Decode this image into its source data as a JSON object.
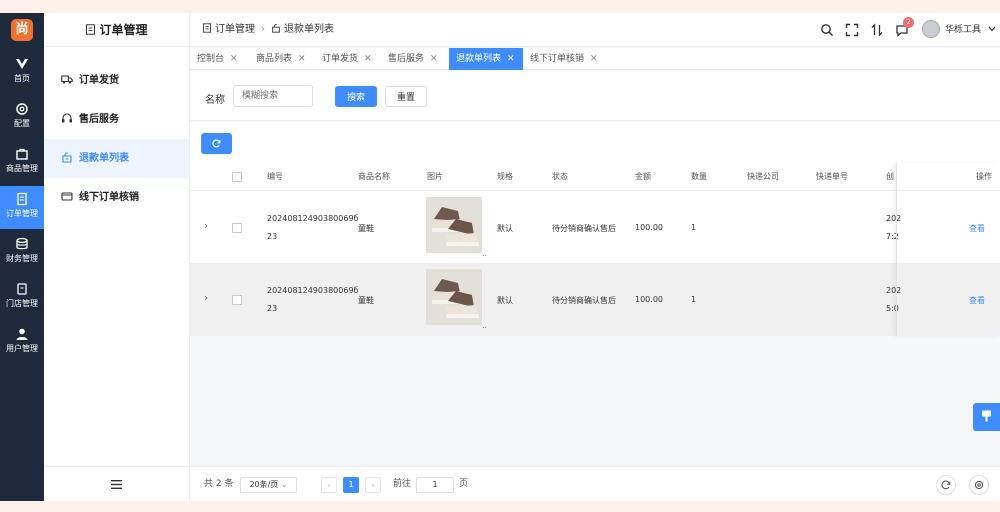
{
  "app": {
    "logo": "尚"
  },
  "rail": [
    {
      "label": "首页",
      "icon": "logo-v-icon"
    },
    {
      "label": "配置",
      "icon": "gear-icon"
    },
    {
      "label": "商品管理",
      "icon": "bag-icon"
    },
    {
      "label": "订单管理",
      "icon": "document-icon",
      "active": true
    },
    {
      "label": "财务管理",
      "icon": "database-icon"
    },
    {
      "label": "门店管理",
      "icon": "store-icon"
    },
    {
      "label": "用户管理",
      "icon": "user-icon"
    }
  ],
  "sidebar": {
    "title": "订单管理",
    "items": [
      {
        "label": "订单发货",
        "icon": "truck-icon"
      },
      {
        "label": "售后服务",
        "icon": "headset-icon"
      },
      {
        "label": "退款单列表",
        "icon": "refund-icon",
        "active": true
      },
      {
        "label": "线下订单核销",
        "icon": "wallet-icon"
      }
    ],
    "collapse_icon": "menu-icon"
  },
  "breadcrumb": {
    "level1": "订单管理",
    "level2": "退款单列表"
  },
  "header": {
    "notification_count": "2",
    "username": "华栎工具"
  },
  "tabs": [
    {
      "label": "控制台"
    },
    {
      "label": "商品列表"
    },
    {
      "label": "订单发货"
    },
    {
      "label": "售后服务"
    },
    {
      "label": "退款单列表",
      "active": true
    },
    {
      "label": "线下订单核销"
    }
  ],
  "filter": {
    "name_label": "名称",
    "name_placeholder": "模糊搜索",
    "search_label": "搜索",
    "reset_label": "重置"
  },
  "table": {
    "columns": [
      "编号",
      "商品名称",
      "图片",
      "规格",
      "状态",
      "金额",
      "数量",
      "快递公司",
      "快递单号",
      "创",
      "操作"
    ],
    "rows": [
      {
        "id_line1": "20240812490380069б",
        "id_line2": "23",
        "product": "童鞋",
        "spec": "默认",
        "status": "待分销商确认售后",
        "amount": "100.00",
        "quantity": "1",
        "created_line1": "202",
        "created_line2": "7:2",
        "action": "查看"
      },
      {
        "id_line1": "20240812490380069б",
        "id_line2": "23",
        "product": "童鞋",
        "spec": "默认",
        "status": "待分销商确认售后",
        "amount": "100.00",
        "quantity": "1",
        "created_line1": "202",
        "created_line2": "5:0",
        "action": "查看"
      }
    ]
  },
  "pagination": {
    "total": "共 2 条",
    "page_size": "20条/页",
    "current_page": "1",
    "goto_label": "前往",
    "goto_value": "1",
    "page_unit": "页"
  }
}
